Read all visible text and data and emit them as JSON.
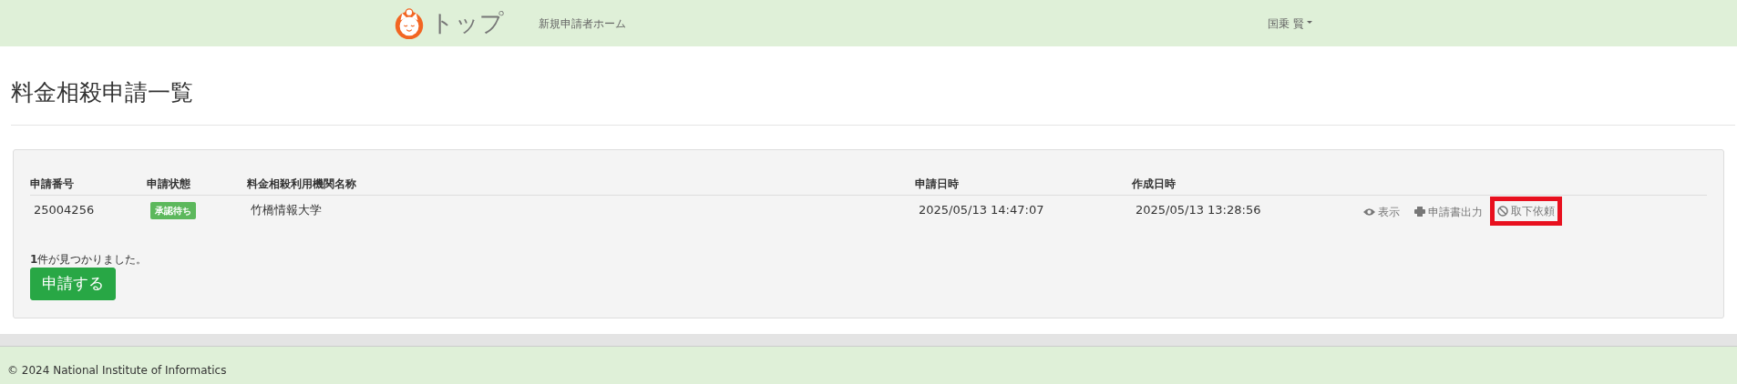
{
  "navbar": {
    "brand": "トップ",
    "links": [
      "新規申請者ホーム"
    ],
    "user": "国乗 賢"
  },
  "page_title": "料金相殺申請一覧",
  "table": {
    "columns": [
      "申請番号",
      "申請状態",
      "料金相殺利用機関名称",
      "申請日時",
      "作成日時"
    ],
    "rows": [
      {
        "number": "25004256",
        "status": "承認待ち",
        "institution": "竹橋情報大学",
        "applied_at": "2025/05/13 14:47:07",
        "created_at": "2025/05/13 13:28:56",
        "actions": [
          {
            "kind": "view",
            "label": "表示",
            "highlighted": false
          },
          {
            "kind": "print",
            "label": "申請書出力",
            "highlighted": false
          },
          {
            "kind": "withdraw",
            "label": "取下依頼",
            "highlighted": true
          }
        ]
      }
    ]
  },
  "result_count": "**1**件が見つかりました。",
  "apply_button": "申請する",
  "footer": "© 2024 National Institute of Informatics"
}
